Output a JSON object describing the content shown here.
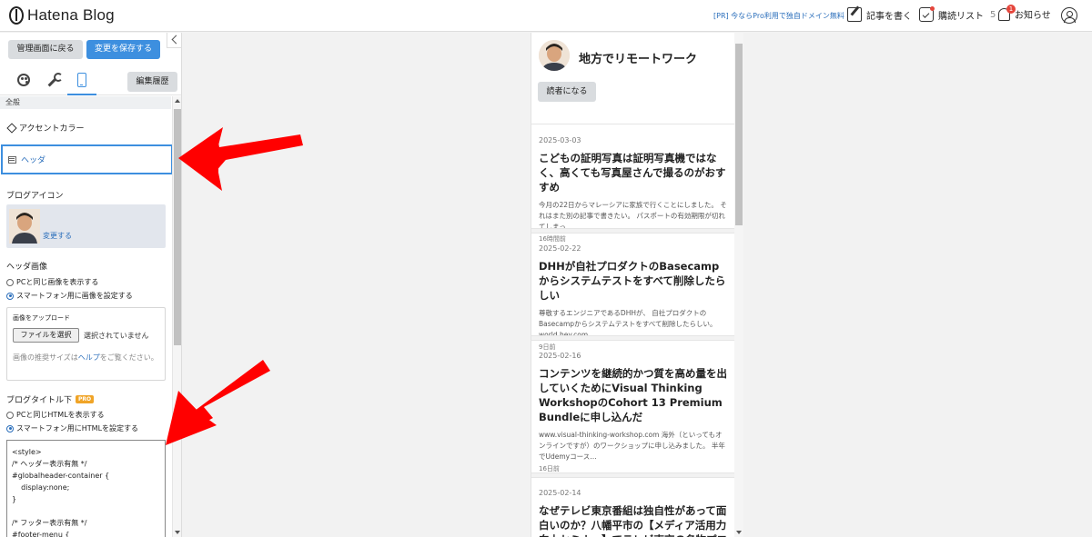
{
  "header": {
    "logo_text": "Hatena Blog",
    "promo": "[PR] 今ならPro利用で独自ドメイン無料",
    "write_label": "記事を書く",
    "reader_label": "購読リスト",
    "reader_count": "5",
    "notice_label": "お知らせ",
    "notice_badge": "1"
  },
  "panel": {
    "back_label": "管理画面に戻る",
    "save_label": "変更を保存する",
    "history_label": "編集履歴",
    "section_general": "全般",
    "accent_label": "アクセントカラー",
    "header_label": "ヘッダ",
    "blog_icon_label": "ブログアイコン",
    "change_link": "変更する",
    "header_image_label": "ヘッダ画像",
    "radio_same_pc": "PCと同じ画像を表示する",
    "radio_smartphone": "スマートフォン用に画像を設定する",
    "upload_title": "画像をアップロード",
    "file_button": "ファイルを選択",
    "file_status": "選択されていません",
    "upload_note_1": "画像の推奨サイズは",
    "upload_note_link": "ヘルプ",
    "upload_note_2": "をご覧ください。",
    "subtitle_label": "ブログタイトル下",
    "pro_badge": "PRO",
    "radio_html_pc": "PCと同じHTMLを表示する",
    "radio_html_sp": "スマートフォン用にHTMLを設定する",
    "code": "<style>\n/* ヘッダー表示有無 */\n#globalheader-container {\n    display:none;\n}\n\n/* フッター表示有無 */\n#footer-menu {"
  },
  "preview": {
    "blog_title": "地方でリモートワーク",
    "follow_label": "読者になる",
    "posts": [
      {
        "date": "2025-03-03",
        "title": "こどもの証明写真は証明写真機ではなく、高くても写真屋さんで撮るのがおすすめ",
        "excerpt": "今月の22日からマレーシアに家族で行くことにしました。 それはまた別の記事で書きたい。 パスポートの有効期限が切れてしまっ…",
        "ago": "16時間前"
      },
      {
        "date": "2025-02-22",
        "title": "DHHが自社プロダクトのBasecampからシステムテストをすべて削除したらしい",
        "excerpt": "尊敬するエンジニアであるDHHが、 自社プロダクトのBasecampからシステムテストをすべて削除したらしい。 world.hey.com",
        "ago": "9日前"
      },
      {
        "date": "2025-02-16",
        "title": "コンテンツを継続的かつ質を高め量を出していくためにVisual Thinking WorkshopのCohort 13 Premium Bundleに申し込んだ",
        "excerpt": "www.visual-thinking-workshop.com 海外（といってもオンラインですが）のワークショップに申し込みました。 半年でUdemyコース…",
        "ago": "16日前"
      },
      {
        "date": "2025-02-14",
        "title": "なぜテレビ東京番組は独自性があって面白いのか？八幡平市の【メディア活用力向上セミナー】でテレビ東京の名物プロデュー",
        "excerpt": "",
        "ago": ""
      }
    ]
  },
  "colors": {
    "accent_blue": "#3d8fdf",
    "link_blue": "#2a6ebb",
    "annotation_red": "#ff0000",
    "pro_orange": "#f0a427"
  }
}
